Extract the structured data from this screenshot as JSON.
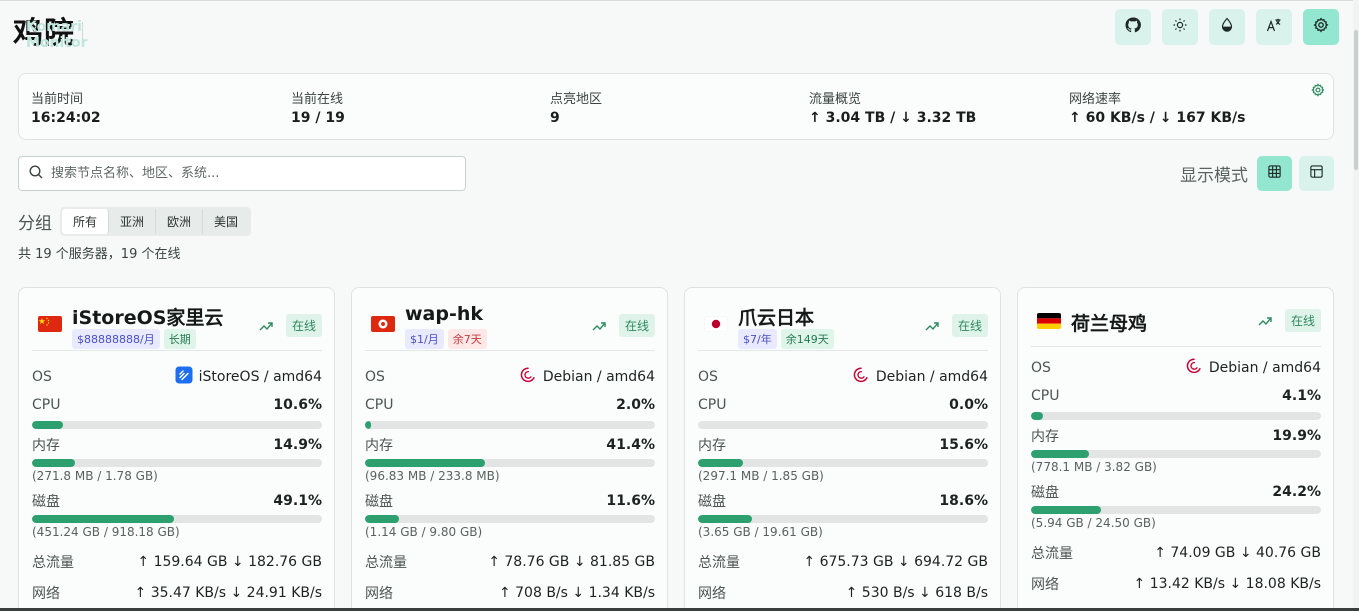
{
  "header": {
    "title": "鸡院",
    "subtitle": "Komari Monitor",
    "buttons": [
      {
        "icon": "github-icon"
      },
      {
        "icon": "sun-icon"
      },
      {
        "icon": "droplet-icon"
      },
      {
        "icon": "language-icon"
      },
      {
        "icon": "gear-icon"
      }
    ]
  },
  "stats": {
    "time_label": "当前时间",
    "time_value": "16:24:02",
    "online_label": "当前在线",
    "online_value": "19 / 19",
    "regions_label": "点亮地区",
    "regions_value": "9",
    "traffic_label": "流量概览",
    "traffic_value": "↑ 3.04 TB / ↓ 3.32 TB",
    "speed_label": "网络速率",
    "speed_value": "↑ 60 KB/s / ↓ 167 KB/s"
  },
  "search": {
    "placeholder": "搜索节点名称、地区、系统..."
  },
  "view": {
    "label": "显示模式"
  },
  "groups": {
    "label": "分组",
    "tabs": [
      "所有",
      "亚洲",
      "欧洲",
      "美国"
    ],
    "active": "所有"
  },
  "summary": "共 19 个服务器，19 个在线",
  "colors": {
    "accent": "#93e6cf",
    "accent_light": "#d9f3ec",
    "bar_fill": "#2ea06f"
  },
  "cards": [
    {
      "name": "iStoreOS家里云",
      "flag": "cn",
      "tags": [
        {
          "text": "$88888888/月",
          "kind": "price"
        },
        {
          "text": "长期",
          "kind": "green"
        }
      ],
      "status": "在线",
      "os_label": "OS",
      "os": "iStoreOS / amd64",
      "os_icon": "istoreos-icon",
      "cpu_label": "CPU",
      "cpu": "10.6%",
      "cpu_pct": 10.6,
      "mem_label": "内存",
      "mem": "14.9%",
      "mem_pct": 14.9,
      "mem_detail": "(271.8 MB / 1.78 GB)",
      "disk_label": "磁盘",
      "disk": "49.1%",
      "disk_pct": 49.1,
      "disk_detail": "(451.24 GB / 918.18 GB)",
      "traffic_label": "总流量",
      "traffic": "↑ 159.64 GB ↓ 182.76 GB",
      "net_label": "网络",
      "net": "↑ 35.47 KB/s ↓ 24.91 KB/s"
    },
    {
      "name": "wap-hk",
      "flag": "hk",
      "tags": [
        {
          "text": "$1/月",
          "kind": "price"
        },
        {
          "text": "余7天",
          "kind": "red"
        }
      ],
      "status": "在线",
      "os_label": "OS",
      "os": "Debian / amd64",
      "os_icon": "debian-icon",
      "cpu_label": "CPU",
      "cpu": "2.0%",
      "cpu_pct": 2.0,
      "mem_label": "内存",
      "mem": "41.4%",
      "mem_pct": 41.4,
      "mem_detail": "(96.83 MB / 233.8 MB)",
      "disk_label": "磁盘",
      "disk": "11.6%",
      "disk_pct": 11.6,
      "disk_detail": "(1.14 GB / 9.80 GB)",
      "traffic_label": "总流量",
      "traffic": "↑ 78.76 GB ↓ 81.85 GB",
      "net_label": "网络",
      "net": "↑ 708 B/s ↓ 1.34 KB/s"
    },
    {
      "name": "爪云日本",
      "flag": "jp",
      "tags": [
        {
          "text": "$7/年",
          "kind": "price"
        },
        {
          "text": "余149天",
          "kind": "green"
        }
      ],
      "status": "在线",
      "os_label": "OS",
      "os": "Debian / amd64",
      "os_icon": "debian-icon",
      "cpu_label": "CPU",
      "cpu": "0.0%",
      "cpu_pct": 0.0,
      "mem_label": "内存",
      "mem": "15.6%",
      "mem_pct": 15.6,
      "mem_detail": "(297.1 MB / 1.85 GB)",
      "disk_label": "磁盘",
      "disk": "18.6%",
      "disk_pct": 18.6,
      "disk_detail": "(3.65 GB / 19.61 GB)",
      "traffic_label": "总流量",
      "traffic": "↑ 675.73 GB ↓ 694.72 GB",
      "net_label": "网络",
      "net": "↑ 530 B/s ↓ 618 B/s"
    },
    {
      "name": "荷兰母鸡",
      "flag": "de",
      "tags": [],
      "status": "在线",
      "os_label": "OS",
      "os": "Debian / amd64",
      "os_icon": "debian-icon",
      "cpu_label": "CPU",
      "cpu": "4.1%",
      "cpu_pct": 4.1,
      "mem_label": "内存",
      "mem": "19.9%",
      "mem_pct": 19.9,
      "mem_detail": "(778.1 MB / 3.82 GB)",
      "disk_label": "磁盘",
      "disk": "24.2%",
      "disk_pct": 24.2,
      "disk_detail": "(5.94 GB / 24.50 GB)",
      "traffic_label": "总流量",
      "traffic": "↑ 74.09 GB ↓ 40.76 GB",
      "net_label": "网络",
      "net": "↑ 13.42 KB/s ↓ 18.08 KB/s"
    }
  ]
}
